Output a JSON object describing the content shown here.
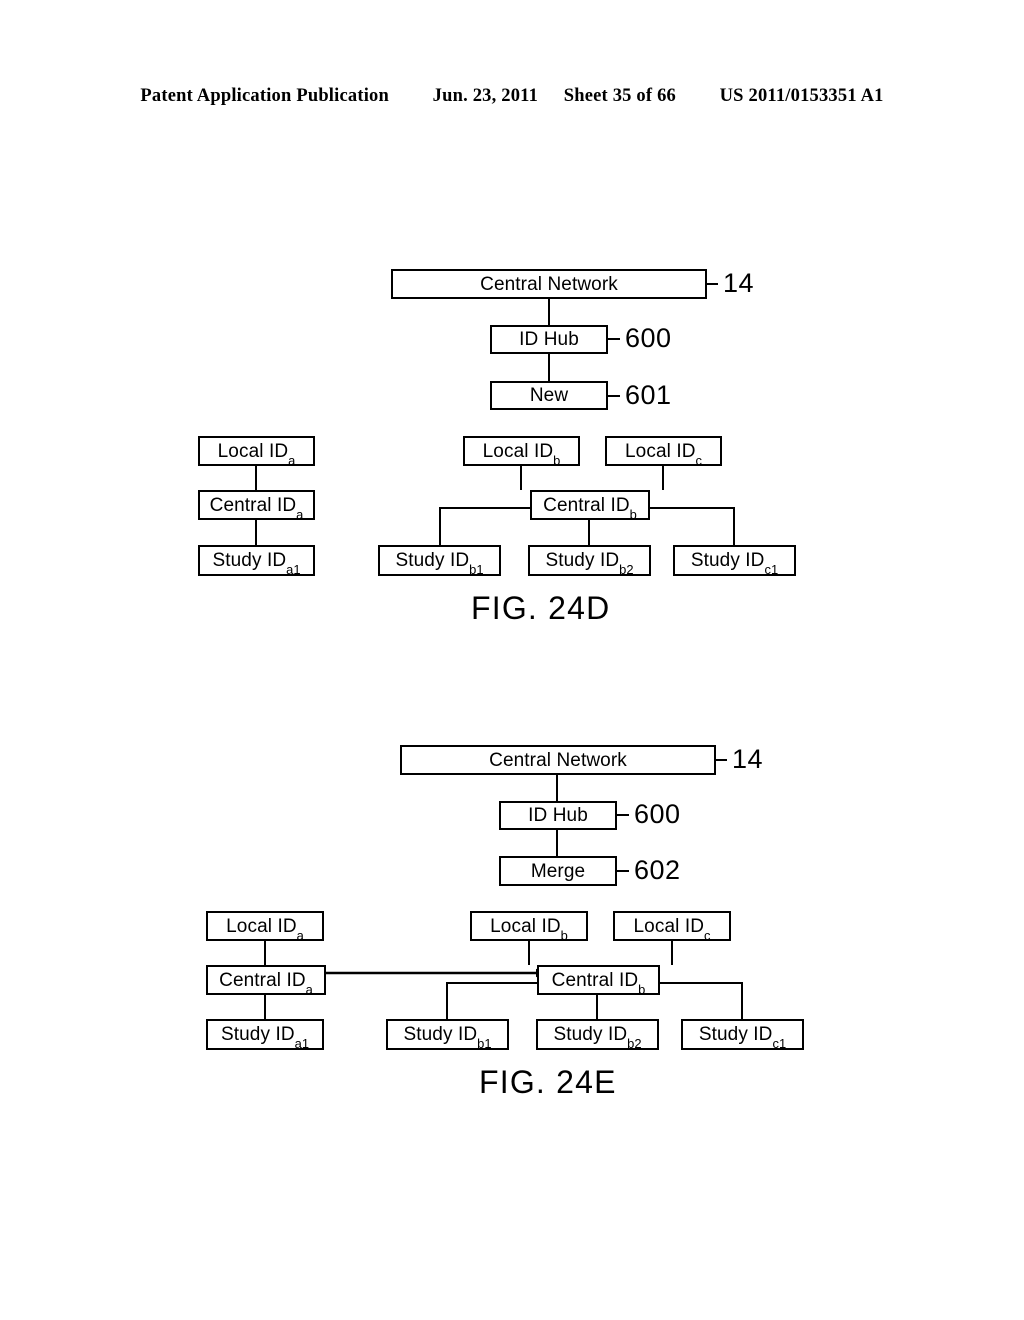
{
  "header": {
    "publication": "Patent Application Publication",
    "date": "Jun. 23, 2011",
    "sheet": "Sheet 35 of 66",
    "patent_number": "US 2011/0153351 A1"
  },
  "figures": [
    {
      "caption": "FIG. 24D",
      "nodes": {
        "central_network": "Central Network",
        "id_hub": "ID Hub",
        "action": "New",
        "local_a": "Local ID",
        "local_a_sub": "a",
        "central_a": "Central ID",
        "central_a_sub": "a",
        "study_a1": "Study ID",
        "study_a1_sub": "a1",
        "local_b": "Local ID",
        "local_b_sub": "b",
        "local_c": "Local ID",
        "local_c_sub": "c",
        "central_b": "Central ID",
        "central_b_sub": "b",
        "study_b1": "Study ID",
        "study_b1_sub": "b1",
        "study_b2": "Study ID",
        "study_b2_sub": "b2",
        "study_c1": "Study ID",
        "study_c1_sub": "c1"
      },
      "refs": {
        "network": "14",
        "hub": "600",
        "action": "601"
      }
    },
    {
      "caption": "FIG. 24E",
      "nodes": {
        "central_network": "Central Network",
        "id_hub": "ID Hub",
        "action": "Merge",
        "local_a": "Local ID",
        "local_a_sub": "a",
        "central_a": "Central ID",
        "central_a_sub": "a",
        "study_a1": "Study ID",
        "study_a1_sub": "a1",
        "local_b": "Local ID",
        "local_b_sub": "b",
        "local_c": "Local ID",
        "local_c_sub": "c",
        "central_b": "Central ID",
        "central_b_sub": "b",
        "study_b1": "Study ID",
        "study_b1_sub": "b1",
        "study_b2": "Study ID",
        "study_b2_sub": "b2",
        "study_c1": "Study ID",
        "study_c1_sub": "c1"
      },
      "refs": {
        "network": "14",
        "hub": "600",
        "action": "602"
      }
    }
  ],
  "colors": {
    "ink": "#000000",
    "paper": "#ffffff"
  }
}
